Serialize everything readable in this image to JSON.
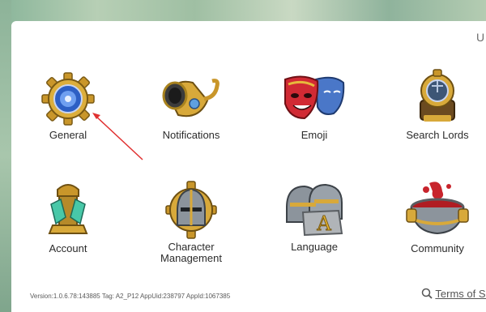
{
  "settings_menu": {
    "top_right_fragment": "U",
    "items": [
      {
        "label": "General",
        "icon": "gear-shield-icon"
      },
      {
        "label": "Notifications",
        "icon": "horn-icon"
      },
      {
        "label": "Emoji",
        "icon": "theater-masks-icon"
      },
      {
        "label": "Search Lords",
        "icon": "magnifier-globe-icon"
      },
      {
        "label": "Account",
        "icon": "crystal-tower-icon"
      },
      {
        "label": "Character Management",
        "label_line1": "Character",
        "label_line2": "Management",
        "icon": "knight-helmet-icon"
      },
      {
        "label": "Language",
        "icon": "letter-a-helmets-icon"
      },
      {
        "label": "Community",
        "icon": "red-cauldron-icon"
      }
    ],
    "version_text": "Version:1.0.6.78:143885 Tag: A2_P12 AppUid:238797 AppId:1067385",
    "terms_text": "Terms of Se"
  },
  "colors": {
    "gold": "#d4a52a",
    "steel": "#8c949c",
    "blue_gem": "#3a6fd6",
    "red": "#c8242c",
    "arrow": "#e03030"
  }
}
